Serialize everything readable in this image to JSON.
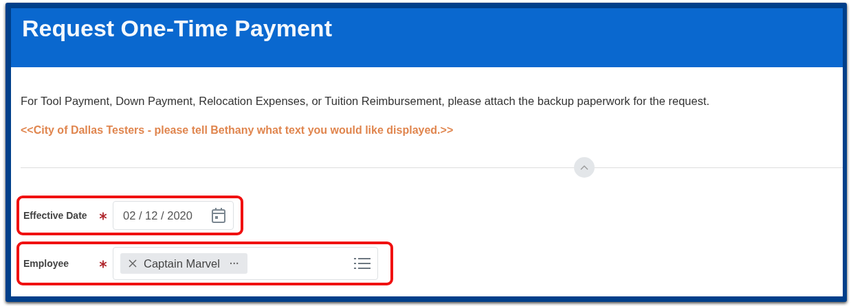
{
  "header": {
    "title": "Request One-Time Payment"
  },
  "instructions": "For Tool Payment, Down Payment, Relocation Expenses, or Tuition Reimbursement, please attach the backup paperwork for the request.",
  "notice": "<<City of Dallas Testers - please tell Bethany what text you would like displayed.>>",
  "section_toggle": {
    "expanded": true
  },
  "fields": [
    {
      "kind": "date",
      "label": "Effective Date",
      "required": true,
      "highlighted": true,
      "value": "02 / 12 / 2020"
    },
    {
      "kind": "prompt",
      "label": "Employee",
      "required": true,
      "highlighted": true,
      "chips": [
        {
          "label": "Captain Marvel",
          "more": "···"
        }
      ]
    }
  ]
}
